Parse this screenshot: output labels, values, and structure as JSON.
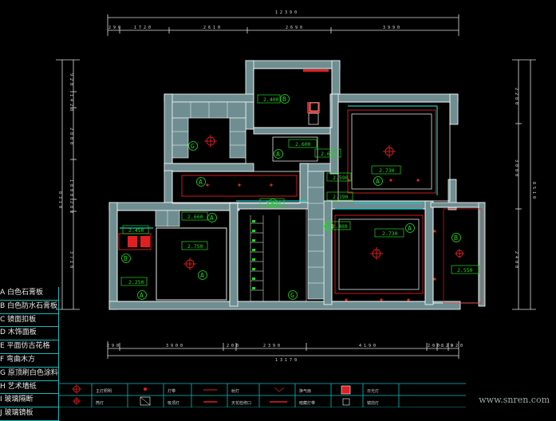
{
  "dimensions": {
    "total_top": "1 2 3 9 0",
    "top_segments": [
      "2 9 0",
      "1 7 2 0",
      "2 6 1 0",
      "2 6 9 0",
      "3 9 9 0"
    ],
    "total_bottom": "1 3 1 7 0",
    "bottom_segments": [
      "2 9 0",
      "3 9 0 0",
      "2 0 0",
      "2 3 9 0",
      "4 1 9 0",
      "2 0 0",
      "8 2 0",
      "9 2 0",
      "2 4 0"
    ],
    "left_total": "8 3 1 0",
    "left_segments": [
      "9 2 0",
      "1 4 2 0",
      "2 8 0 0",
      "1 8 0 0",
      "2 8 0",
      "3 7 1 0"
    ],
    "right_total": "8 5 1 0",
    "right_segments": [
      "2 2 8 0",
      "3 0 0 0",
      "2 4 0 0"
    ]
  },
  "rooms": {
    "letters": [
      "B",
      "G",
      "A",
      "A",
      "A",
      "A",
      "A",
      "B",
      "G",
      "A",
      "B",
      "B",
      "G",
      "A"
    ],
    "levels": [
      "2.400",
      "2.600",
      "2.600",
      "2.590",
      "2.730",
      "2.190",
      "2.660",
      "2.400",
      "2.250",
      "2.730",
      "2.450",
      "2.750",
      "2.550",
      "2.400"
    ]
  },
  "legend": [
    "A 白色石膏板",
    "B 白色防水石膏板",
    "C 镜面扣板",
    "D 木饰面板",
    "E 平面仿古花格",
    "F 弯曲木方",
    "G 原顶刷白色涂料",
    "H 艺术墙纸",
    "I 玻璃隔断",
    "J 玻璃镜板"
  ],
  "symbols": {
    "labels": [
      "主灯照明",
      "筒灯",
      "灯带",
      "射灯",
      "换气扇",
      "吸顶灯",
      "天花检修口",
      "暗藏灯带",
      "日光灯",
      "镜前灯"
    ]
  },
  "watermark": "www.snren.com",
  "colors": {
    "wall": "#6f8e91",
    "room_line": "#ffffff",
    "cyan": "#17c7c7",
    "green": "#1fdb1f",
    "red": "#e02020",
    "magenta": "#ff3cff"
  }
}
